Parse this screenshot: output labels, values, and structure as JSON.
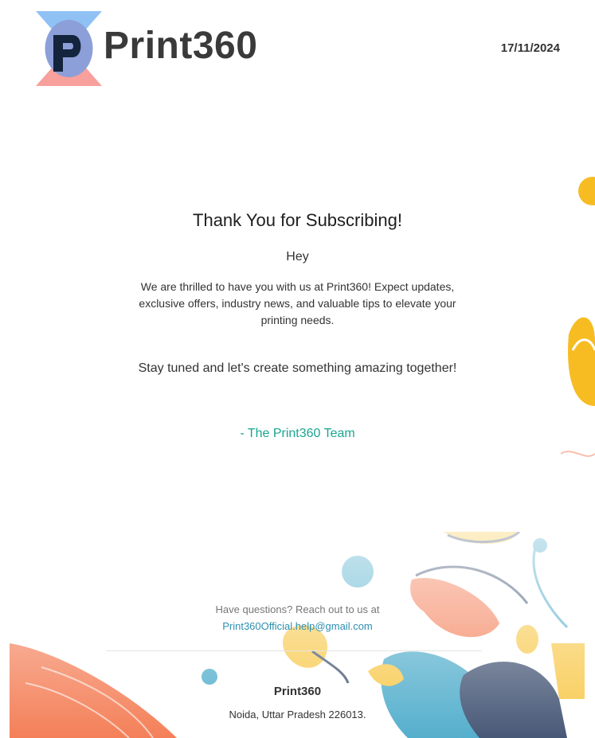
{
  "header": {
    "logo_icon": "print360-logo-icon",
    "brand_name": "Print360",
    "date": "17/11/2024"
  },
  "message": {
    "title": "Thank You for Subscribing!",
    "greeting": "Hey",
    "body": "We are thrilled to have you with us at Print360! Expect updates, exclusive offers, industry news, and valuable tips to elevate your printing needs.",
    "stay_tuned": "Stay tuned and let's create something amazing together!",
    "signoff": "- The Print360 Team"
  },
  "contact": {
    "question": "Have questions? Reach out to us at",
    "email": "Print360Official.help@gmail.com",
    "email_href": "mailto:Print360Official.help@gmail.com"
  },
  "footer": {
    "brand_name": "Print360",
    "address": "Noida, Uttar Pradesh 226013."
  },
  "colors": {
    "accent_teal": "#1aa592",
    "link_blue": "#2e8fb0",
    "deco_orange": "#f1602f",
    "deco_yellow": "#f6bc22",
    "deco_navy": "#1a2f55",
    "deco_teal": "#2a9bc0"
  }
}
